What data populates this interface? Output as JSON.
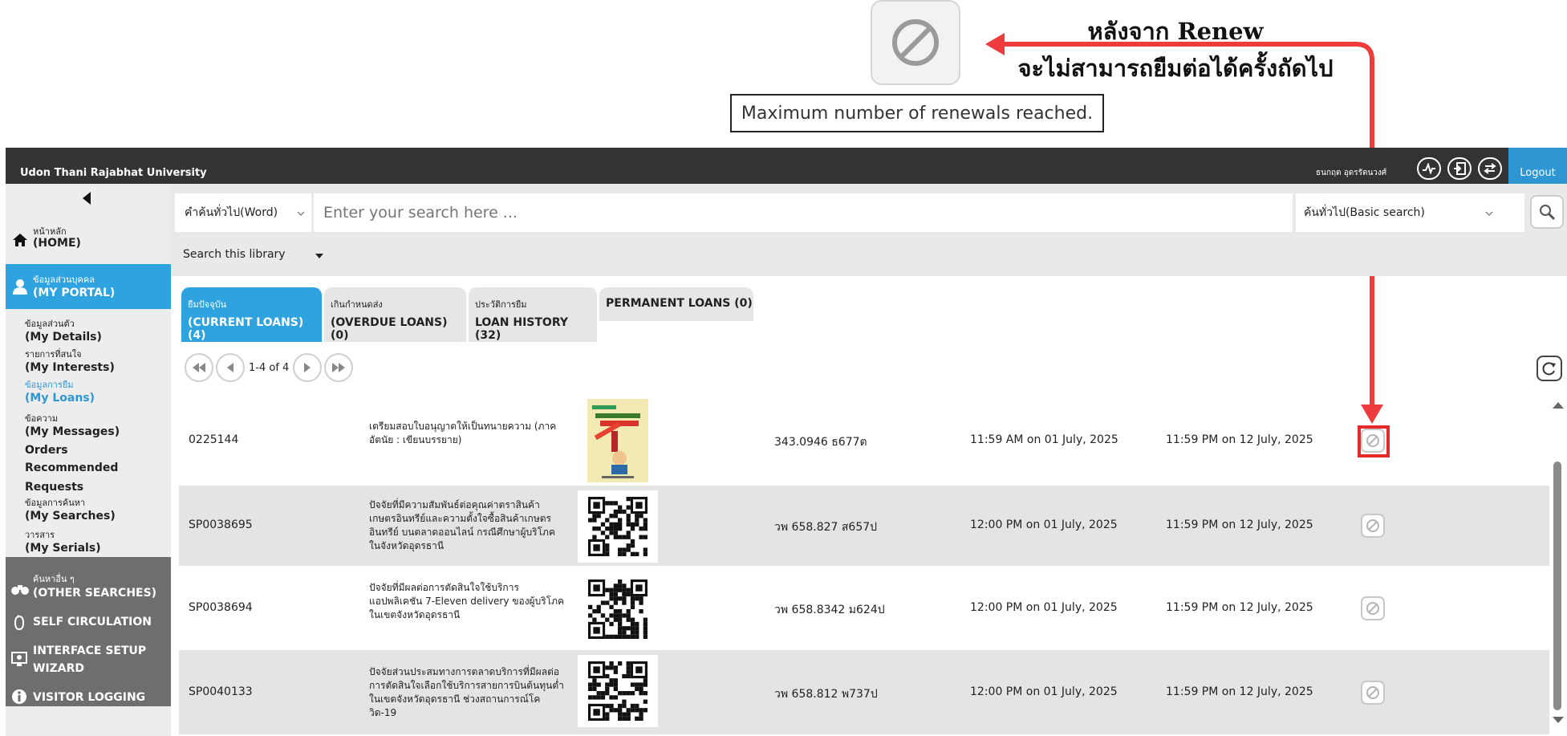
{
  "annotation": {
    "tooltip": "Maximum number of renewals reached.",
    "line1": "หลังจาก Renew",
    "line2": "จะไม่สามารถยืมต่อได้ครั้งถัดไป",
    "arrow_color": "#ee3b3b"
  },
  "app": {
    "name": "Udon Thani Rajabhat University",
    "user": "ธนกฤต อุดรรัตนวงศ์",
    "logout": "Logout",
    "header_icons": [
      "activity-icon",
      "checkout-icon",
      "switch-icon"
    ]
  },
  "sidebar": {
    "home_th": "หน้าหลัก",
    "home_en": "(HOME)",
    "portal_th": "ข้อมูลส่วนบุคคล",
    "portal_en": "(MY PORTAL)",
    "sub": [
      {
        "th": "ข้อมูลส่วนตัว",
        "en": "(My Details)"
      },
      {
        "th": "รายการที่สนใจ",
        "en": "(My Interests)"
      },
      {
        "th": "ข้อมูลการยืม",
        "en": "(My Loans)"
      },
      {
        "th": "ข้อความ",
        "en": "(My Messages)"
      },
      {
        "th": "",
        "en": "Orders"
      },
      {
        "th": "",
        "en": "Recommended"
      },
      {
        "th": "",
        "en": "Requests"
      },
      {
        "th": "ข้อมูลการค้นหา",
        "en": "(My Searches)"
      },
      {
        "th": "วารสาร",
        "en": "(My Serials)"
      }
    ],
    "other_th": "ค้นหาอื่น ๆ",
    "other_en": "(OTHER SEARCHES)",
    "self_circ": "SELF CIRCULATION",
    "interface_1": "INTERFACE SETUP",
    "interface_2": "WIZARD",
    "visitor": "VISITOR LOGGING",
    "accent": "#2fa3df"
  },
  "search": {
    "type": "คำค้นทั่วไป(Word)",
    "placeholder": "Enter your search here ...",
    "mode": "ค้นทั่วไป(Basic search)",
    "library": "Search this library"
  },
  "tabs": [
    {
      "th": "ยืมปัจจุบัน",
      "en": "(CURRENT LOANS) (4)"
    },
    {
      "th": "เกินกำหนดส่ง",
      "en": "(OVERDUE LOANS) (0)"
    },
    {
      "th": "ประวัติการยืม",
      "en": "LOAN HISTORY (32)"
    },
    {
      "th": "",
      "en": "PERMANENT LOANS (0)"
    }
  ],
  "pager": {
    "text": "1-4 of 4"
  },
  "loans": [
    {
      "barcode": "0225144",
      "title": "เตรียมสอบใบอนุญาตให้เป็นทนายความ (ภาคอัตนัย : เขียนบรรยาย)",
      "call_no": "343.0946 ธ677ต",
      "checkout": "11:59 AM on 01 July, 2025",
      "due": "11:59 PM on 12 July, 2025",
      "cover": "book"
    },
    {
      "barcode": "SP0038695",
      "title": "ปัจจัยที่มีความสัมพันธ์ต่อคุณค่าตราสินค้าเกษตรอินทรีย์และความตั้งใจซื้อสินค้าเกษตรอินทรีย์ บนตลาดออนไลน์ กรณีศึกษาผู้บริโภคในจังหวัดอุดรธานี",
      "call_no": "วพ 658.827 ส657ป",
      "checkout": "12:00 PM on 01 July, 2025",
      "due": "11:59 PM on 12 July, 2025",
      "cover": "qr"
    },
    {
      "barcode": "SP0038694",
      "title": "ปัจจัยที่มีผลต่อการตัดสินใจใช้บริการแอปพลิเคชัน 7-Eleven delivery ของผู้บริโภคในเขตจังหวัดอุดรธานี",
      "call_no": "วพ 658.8342 ม624ป",
      "checkout": "12:00 PM on 01 July, 2025",
      "due": "11:59 PM on 12 July, 2025",
      "cover": "qr"
    },
    {
      "barcode": "SP0040133",
      "title": "ปัจจัยส่วนประสมทางการตลาดบริการที่มีผลต่อการตัดสินใจเลือกใช้บริการสายการบินต้นทุนต่ำในเขตจังหวัดอุดรธานี ช่วงสถานการณ์โควิด-19",
      "call_no": "วพ 658.812 พ737ป",
      "checkout": "12:00 PM on 01 July, 2025",
      "due": "11:59 PM on 12 July, 2025",
      "cover": "qr"
    }
  ]
}
